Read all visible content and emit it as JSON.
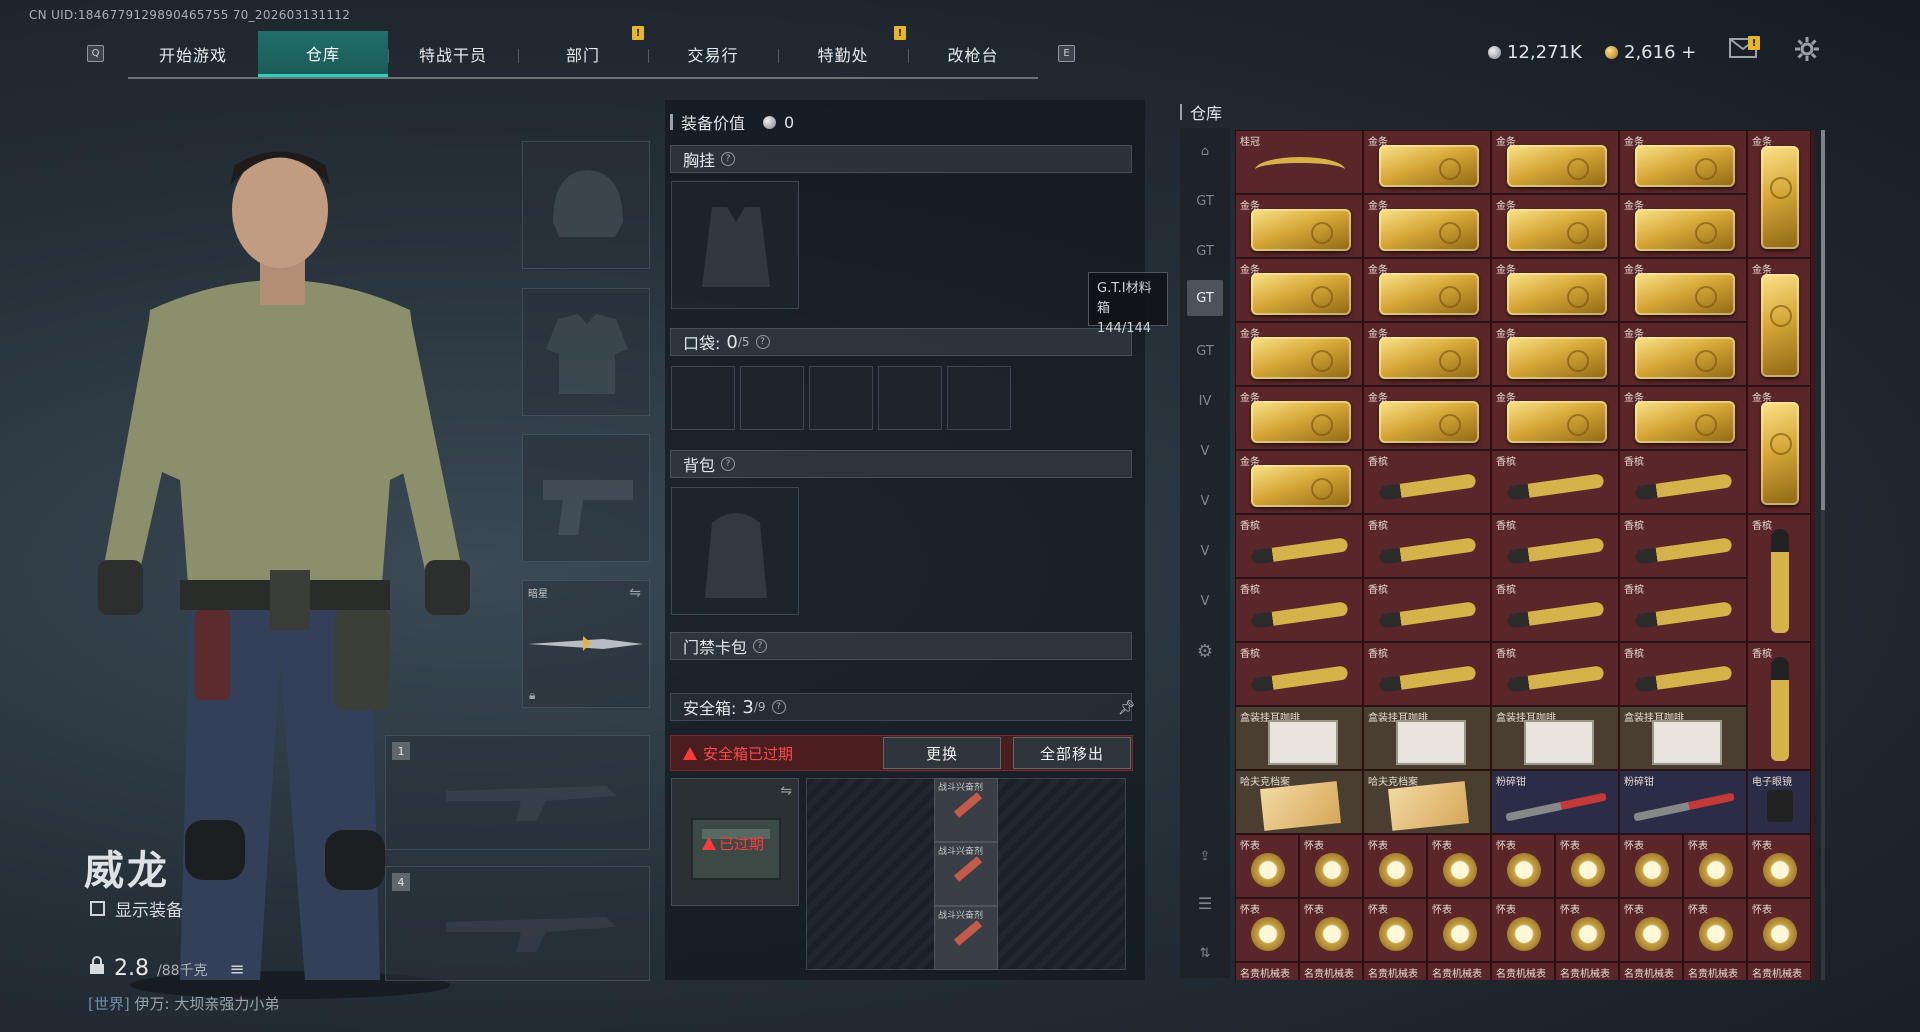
{
  "uid_text": "CN UID:1846779129890465755 70_202603131112",
  "nav": {
    "left_key": "Q",
    "right_key": "E",
    "tabs": [
      "开始游戏",
      "仓库",
      "特战干员",
      "部门",
      "交易行",
      "特勤处",
      "改枪台"
    ],
    "active_index": 1,
    "badges": [
      "!",
      "!"
    ]
  },
  "currency": {
    "silver": "12,271K",
    "gold": "2,616 +"
  },
  "top_icons": [
    "mail-icon",
    "gear-icon"
  ],
  "mail_badge": "!",
  "character": {
    "name": "威龙",
    "show_equipment_label": "显示装备",
    "weight_value": "2.8",
    "weight_max": "/88千克",
    "chat_channel": "[世界]",
    "chat_user": "伊万:",
    "chat_message": "大坝亲强力小弟"
  },
  "slots": {
    "melee_label": "暗星",
    "primary_1_num": "1",
    "primary_4_num": "4"
  },
  "loadout": {
    "value_label": "装备价值",
    "value_amount": "0",
    "chest_rig": "胸挂",
    "pockets": "口袋:",
    "pockets_count": "0",
    "pockets_max": "/5",
    "backpack": "背包",
    "keycard": "门禁卡包",
    "safe_box": "安全箱:",
    "safe_count": "3",
    "safe_max": "/9",
    "expired_text": "安全箱已过期",
    "replace_button": "更换",
    "remove_all_button": "全部移出",
    "expired_badge": "已过期",
    "safe_item_label": "战斗兴奋剂"
  },
  "tooltip": {
    "title": "G.T.I材料箱",
    "count": "144/144"
  },
  "warehouse": {
    "title": "仓库",
    "item_labels": {
      "tiara": "桂冠",
      "gold": "金条",
      "champagne": "香槟",
      "box": "盒装挂耳咖啡",
      "cigar": "哈夫克档案",
      "pliers": "粉碎钳",
      "ebox": "电子眼镜",
      "watch": "怀表",
      "mech": "名贵机械表"
    }
  },
  "colors": {
    "accent": "#2fd1b6",
    "tab_active": "#1f6f69",
    "item_red": "#5a2629",
    "item_blue": "#2a2d45",
    "expired_red": "#ff4a4a"
  }
}
